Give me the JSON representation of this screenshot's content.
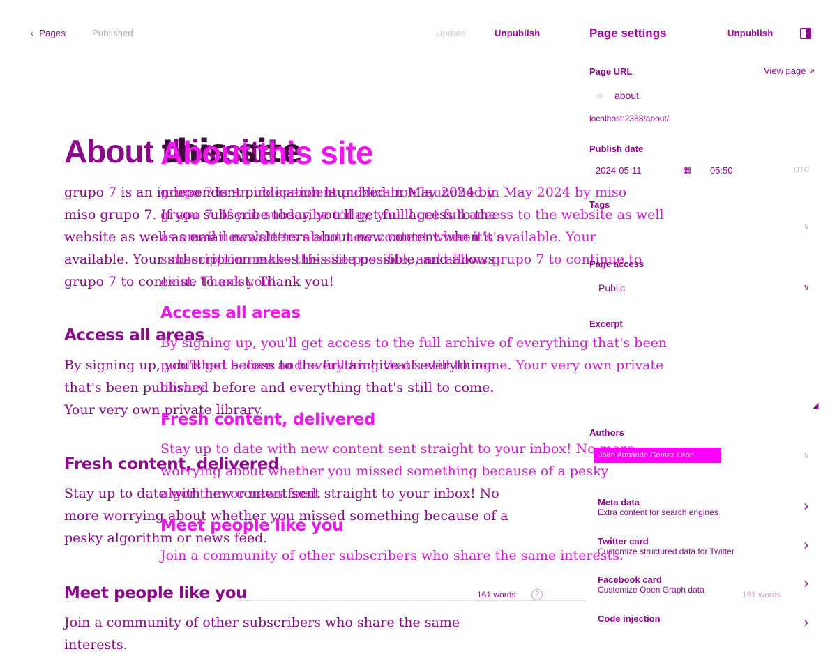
{
  "topbar": {
    "back_label": "Pages",
    "status": "Published",
    "update_label": "Update",
    "unpublish_label": "Unpublish",
    "panel_title": "Page settings",
    "panel_unpublish_label": "Unpublish"
  },
  "editor": {
    "title": "About this site",
    "title_overlay_fragment": "this site",
    "intro": "grupo 7 is an independent publication launched in May 2024 by miso grupo 7. If you subscribe today, you'll get full access to the website as well as email newsletters about new content when it's available. Your subscription makes this site possible, and allows grupo 7 to continue to exist. Thank you!",
    "sections": [
      {
        "heading": "Access all areas",
        "body": "By signing up, you'll get access to the full archive of everything that's been published before and everything that's still to come. Your very own private library."
      },
      {
        "heading": "Fresh content, delivered",
        "body": "Stay up to date with new content sent straight to your inbox! No more worrying about whether you missed something because of a pesky algorithm or news feed."
      },
      {
        "heading": "Meet people like you",
        "body": "Join a community of other subscribers who share the same interests."
      }
    ],
    "word_count": "161 words"
  },
  "settings": {
    "page_url_label": "Page URL",
    "view_page_label": "View page",
    "url_slug": "about",
    "full_url": "localhost:2368/about/",
    "publish_date_label": "Publish date",
    "date": "2024-05-11",
    "time": "05:50",
    "timezone": "UTC",
    "tags_label": "Tags",
    "page_access_label": "Page access",
    "page_access_value": "Public",
    "excerpt_label": "Excerpt",
    "authors_label": "Authors",
    "author_chip": "Jairo Armando Gomez Leon",
    "menu": [
      {
        "title": "Meta data",
        "sub": "Extra content for search engines"
      },
      {
        "title": "Twitter card",
        "sub": "Customize structured data for Twitter"
      },
      {
        "title": "Facebook card",
        "sub": "Customize Open Graph data"
      },
      {
        "title": "Code injection",
        "sub": ""
      }
    ],
    "word_count": "161 words"
  },
  "colors": {
    "accent": "#ee16ee",
    "text": "#8a0a8a",
    "chip": "#ff00ff"
  }
}
